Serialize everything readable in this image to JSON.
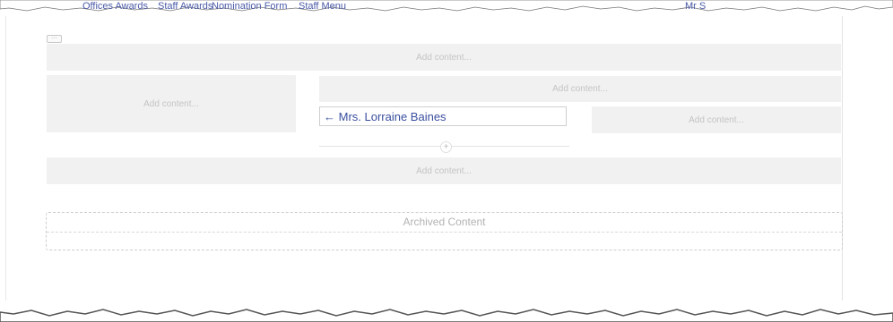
{
  "topnav": {
    "crumb_1": "Offices Awards",
    "crumb_2": "Staff Awards",
    "crumb_3": "Nomination Form",
    "crumb_4": "Staff Menu",
    "user": "Mr S"
  },
  "blocks": {
    "full_top": "Add content...",
    "left": "Add content...",
    "right_top": "Add content...",
    "right_small": "Add content...",
    "full_bottom": "Add content..."
  },
  "link": {
    "label": "← Mrs. Lorraine Baines"
  },
  "add_circle": "+",
  "archived": {
    "title": "Archived Content"
  },
  "colors": {
    "link": "#3a4f9f",
    "placeholder_bg": "#f1f1f1",
    "placeholder_text": "#c4c4c4"
  }
}
